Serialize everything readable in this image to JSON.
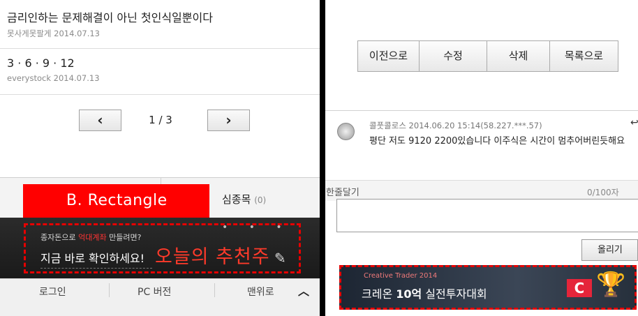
{
  "left": {
    "articles": [
      {
        "title": "금리인하는 문제해결이 아닌 첫인식일뿐이다",
        "author": "못사게못팔게",
        "date": "2014.07.13"
      },
      {
        "title": "3 · 6 · 9 · 12",
        "author": "everystock",
        "date": "2014.07.13"
      }
    ],
    "pager": {
      "prev": "‹",
      "next": "›",
      "indicator": "1 / 3"
    },
    "tab": {
      "label": "심종목",
      "count": "(0)"
    },
    "annotation": {
      "label": "B.   Rectangle"
    },
    "ad": {
      "line1_prefix": "종자돈으로 ",
      "line1_highlight": "억대계좌",
      "line1_suffix": " 만들려면?",
      "line2": "지금 바로 확인하세요!",
      "headline": "오늘의 추천주",
      "dots": "• • •",
      "pencil": "✎"
    },
    "footer": {
      "login": "로그인",
      "pc": "PC 버전",
      "top": "맨위로",
      "chevron": "︿"
    }
  },
  "right": {
    "buttons": [
      "이전으로",
      "수정",
      "삭제",
      "목록으로"
    ],
    "comment": {
      "meta": "콜풋콜로스 2014.06.20 15:14(58.227.***.57)",
      "text": "평단 저도 9120 2200있습니다 이주식은 시간이 멈추어버린듯해요",
      "arrow": "↩"
    },
    "reply": {
      "label": "한줄달기",
      "count": "0/100자",
      "submit": "올리기"
    },
    "ad": {
      "small": "Creative Trader 2014",
      "big_prefix": "크레온 ",
      "big_bold": "10억",
      "big_suffix": " 실전투자대회",
      "logo": "C",
      "trophy": "🏆"
    }
  },
  "colors": {
    "accent_red": "#ff0000",
    "dashed_border": "#e60000"
  }
}
